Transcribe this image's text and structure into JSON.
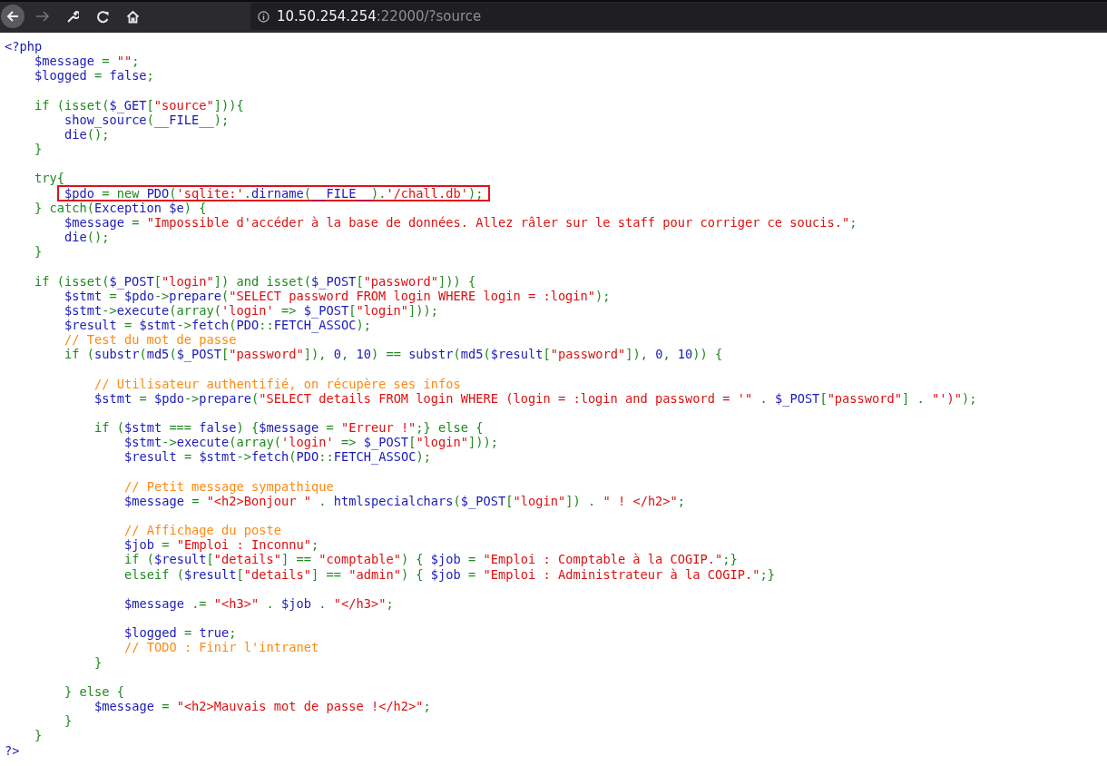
{
  "browser": {
    "url_host": "10.50.254.254",
    "url_rest": ":22000/?source"
  },
  "code": {
    "blocks": [
      [
        {
          "tokens": [
            {
              "kind": "default",
              "text": "<?php"
            }
          ]
        },
        {
          "tokens": [
            {
              "kind": "default",
              "text": "    $message"
            },
            {
              "kind": "keyword",
              "text": " = "
            },
            {
              "kind": "string",
              "text": "\"\""
            },
            {
              "kind": "keyword",
              "text": ";"
            }
          ]
        },
        {
          "tokens": [
            {
              "kind": "default",
              "text": "    $logged"
            },
            {
              "kind": "keyword",
              "text": " = "
            },
            {
              "kind": "default",
              "text": "false"
            },
            {
              "kind": "keyword",
              "text": ";"
            }
          ]
        }
      ],
      [
        {
          "tokens": [
            {
              "kind": "keyword",
              "text": "    if (isset("
            },
            {
              "kind": "default",
              "text": "$_GET"
            },
            {
              "kind": "keyword",
              "text": "["
            },
            {
              "kind": "string",
              "text": "\"source\""
            },
            {
              "kind": "keyword",
              "text": "])){"
            }
          ]
        },
        {
          "tokens": [
            {
              "kind": "default",
              "text": "        show_source"
            },
            {
              "kind": "keyword",
              "text": "("
            },
            {
              "kind": "default",
              "text": "__FILE__"
            },
            {
              "kind": "keyword",
              "text": ");"
            }
          ]
        },
        {
          "tokens": [
            {
              "kind": "default",
              "text": "        die"
            },
            {
              "kind": "keyword",
              "text": "();"
            }
          ]
        },
        {
          "tokens": [
            {
              "kind": "keyword",
              "text": "    }"
            }
          ]
        }
      ],
      [
        {
          "tokens": [
            {
              "kind": "keyword",
              "text": "    try{"
            }
          ]
        },
        {
          "boxed": true,
          "tokens": [
            {
              "kind": "default",
              "text": "        $pdo"
            },
            {
              "kind": "keyword",
              "text": " = new "
            },
            {
              "kind": "default",
              "text": "PDO"
            },
            {
              "kind": "keyword",
              "text": "("
            },
            {
              "kind": "string",
              "text": "'sqlite:'"
            },
            {
              "kind": "keyword",
              "text": "."
            },
            {
              "kind": "default",
              "text": "dirname"
            },
            {
              "kind": "keyword",
              "text": "("
            },
            {
              "kind": "default",
              "text": "__FILE__"
            },
            {
              "kind": "keyword",
              "text": ")."
            },
            {
              "kind": "string",
              "text": "'/chall.db'"
            },
            {
              "kind": "keyword",
              "text": ");"
            }
          ]
        },
        {
          "tokens": [
            {
              "kind": "keyword",
              "text": "    } catch("
            },
            {
              "kind": "default",
              "text": "Exception $e"
            },
            {
              "kind": "keyword",
              "text": ") {"
            }
          ]
        },
        {
          "tokens": [
            {
              "kind": "default",
              "text": "        $message"
            },
            {
              "kind": "keyword",
              "text": " = "
            },
            {
              "kind": "string",
              "text": "\"Impossible d'accéder à la base de données. Allez râler sur le staff pour corriger ce soucis.\""
            },
            {
              "kind": "keyword",
              "text": ";"
            }
          ]
        },
        {
          "tokens": [
            {
              "kind": "default",
              "text": "        die"
            },
            {
              "kind": "keyword",
              "text": "();"
            }
          ]
        },
        {
          "tokens": [
            {
              "kind": "keyword",
              "text": "    }"
            }
          ]
        }
      ],
      [
        {
          "tokens": [
            {
              "kind": "keyword",
              "text": "    if (isset("
            },
            {
              "kind": "default",
              "text": "$_POST"
            },
            {
              "kind": "keyword",
              "text": "["
            },
            {
              "kind": "string",
              "text": "\"login\""
            },
            {
              "kind": "keyword",
              "text": "]) and isset("
            },
            {
              "kind": "default",
              "text": "$_POST"
            },
            {
              "kind": "keyword",
              "text": "["
            },
            {
              "kind": "string",
              "text": "\"password\""
            },
            {
              "kind": "keyword",
              "text": "])) {"
            }
          ]
        },
        {
          "tokens": [
            {
              "kind": "default",
              "text": "        $stmt"
            },
            {
              "kind": "keyword",
              "text": " = "
            },
            {
              "kind": "default",
              "text": "$pdo"
            },
            {
              "kind": "keyword",
              "text": "->"
            },
            {
              "kind": "default",
              "text": "prepare"
            },
            {
              "kind": "keyword",
              "text": "("
            },
            {
              "kind": "string",
              "text": "\"SELECT password FROM login WHERE login = :login\""
            },
            {
              "kind": "keyword",
              "text": ");"
            }
          ]
        },
        {
          "tokens": [
            {
              "kind": "default",
              "text": "        $stmt"
            },
            {
              "kind": "keyword",
              "text": "->"
            },
            {
              "kind": "default",
              "text": "execute"
            },
            {
              "kind": "keyword",
              "text": "(array("
            },
            {
              "kind": "string",
              "text": "'login'"
            },
            {
              "kind": "keyword",
              "text": " => "
            },
            {
              "kind": "default",
              "text": "$_POST"
            },
            {
              "kind": "keyword",
              "text": "["
            },
            {
              "kind": "string",
              "text": "\"login\""
            },
            {
              "kind": "keyword",
              "text": "]));"
            }
          ]
        },
        {
          "tokens": [
            {
              "kind": "default",
              "text": "        $result"
            },
            {
              "kind": "keyword",
              "text": " = "
            },
            {
              "kind": "default",
              "text": "$stmt"
            },
            {
              "kind": "keyword",
              "text": "->"
            },
            {
              "kind": "default",
              "text": "fetch"
            },
            {
              "kind": "keyword",
              "text": "("
            },
            {
              "kind": "default",
              "text": "PDO"
            },
            {
              "kind": "keyword",
              "text": "::"
            },
            {
              "kind": "default",
              "text": "FETCH_ASSOC"
            },
            {
              "kind": "keyword",
              "text": ");"
            }
          ]
        },
        {
          "tokens": [
            {
              "kind": "comment",
              "text": "        // Test du mot de passe"
            }
          ]
        },
        {
          "tokens": [
            {
              "kind": "keyword",
              "text": "        if ("
            },
            {
              "kind": "default",
              "text": "substr"
            },
            {
              "kind": "keyword",
              "text": "("
            },
            {
              "kind": "default",
              "text": "md5"
            },
            {
              "kind": "keyword",
              "text": "("
            },
            {
              "kind": "default",
              "text": "$_POST"
            },
            {
              "kind": "keyword",
              "text": "["
            },
            {
              "kind": "string",
              "text": "\"password\""
            },
            {
              "kind": "keyword",
              "text": "]), "
            },
            {
              "kind": "default",
              "text": "0"
            },
            {
              "kind": "keyword",
              "text": ", "
            },
            {
              "kind": "default",
              "text": "10"
            },
            {
              "kind": "keyword",
              "text": ") == "
            },
            {
              "kind": "default",
              "text": "substr"
            },
            {
              "kind": "keyword",
              "text": "("
            },
            {
              "kind": "default",
              "text": "md5"
            },
            {
              "kind": "keyword",
              "text": "("
            },
            {
              "kind": "default",
              "text": "$result"
            },
            {
              "kind": "keyword",
              "text": "["
            },
            {
              "kind": "string",
              "text": "\"password\""
            },
            {
              "kind": "keyword",
              "text": "]), "
            },
            {
              "kind": "default",
              "text": "0"
            },
            {
              "kind": "keyword",
              "text": ", "
            },
            {
              "kind": "default",
              "text": "10"
            },
            {
              "kind": "keyword",
              "text": ")) {"
            }
          ]
        }
      ],
      [
        {
          "tokens": [
            {
              "kind": "comment",
              "text": "            // Utilisateur authentifié, on récupère ses infos"
            }
          ]
        },
        {
          "tokens": [
            {
              "kind": "default",
              "text": "            $stmt"
            },
            {
              "kind": "keyword",
              "text": " = "
            },
            {
              "kind": "default",
              "text": "$pdo"
            },
            {
              "kind": "keyword",
              "text": "->"
            },
            {
              "kind": "default",
              "text": "prepare"
            },
            {
              "kind": "keyword",
              "text": "("
            },
            {
              "kind": "string",
              "text": "\"SELECT details FROM login WHERE (login = :login and password = '\""
            },
            {
              "kind": "keyword",
              "text": " . "
            },
            {
              "kind": "default",
              "text": "$_POST"
            },
            {
              "kind": "keyword",
              "text": "["
            },
            {
              "kind": "string",
              "text": "\"password\""
            },
            {
              "kind": "keyword",
              "text": "] . "
            },
            {
              "kind": "string",
              "text": "\"')\""
            },
            {
              "kind": "keyword",
              "text": ");"
            }
          ]
        }
      ],
      [
        {
          "tokens": [
            {
              "kind": "keyword",
              "text": "            if ("
            },
            {
              "kind": "default",
              "text": "$stmt"
            },
            {
              "kind": "keyword",
              "text": " === "
            },
            {
              "kind": "default",
              "text": "false"
            },
            {
              "kind": "keyword",
              "text": ") {"
            },
            {
              "kind": "default",
              "text": "$message"
            },
            {
              "kind": "keyword",
              "text": " = "
            },
            {
              "kind": "string",
              "text": "\"Erreur !\""
            },
            {
              "kind": "keyword",
              "text": ";} else {"
            }
          ]
        },
        {
          "tokens": [
            {
              "kind": "default",
              "text": "                $stmt"
            },
            {
              "kind": "keyword",
              "text": "->"
            },
            {
              "kind": "default",
              "text": "execute"
            },
            {
              "kind": "keyword",
              "text": "(array("
            },
            {
              "kind": "string",
              "text": "'login'"
            },
            {
              "kind": "keyword",
              "text": " => "
            },
            {
              "kind": "default",
              "text": "$_POST"
            },
            {
              "kind": "keyword",
              "text": "["
            },
            {
              "kind": "string",
              "text": "\"login\""
            },
            {
              "kind": "keyword",
              "text": "]));"
            }
          ]
        },
        {
          "tokens": [
            {
              "kind": "default",
              "text": "                $result"
            },
            {
              "kind": "keyword",
              "text": " = "
            },
            {
              "kind": "default",
              "text": "$stmt"
            },
            {
              "kind": "keyword",
              "text": "->"
            },
            {
              "kind": "default",
              "text": "fetch"
            },
            {
              "kind": "keyword",
              "text": "("
            },
            {
              "kind": "default",
              "text": "PDO"
            },
            {
              "kind": "keyword",
              "text": "::"
            },
            {
              "kind": "default",
              "text": "FETCH_ASSOC"
            },
            {
              "kind": "keyword",
              "text": ");"
            }
          ]
        }
      ],
      [
        {
          "tokens": [
            {
              "kind": "comment",
              "text": "                // Petit message sympathique"
            }
          ]
        },
        {
          "tokens": [
            {
              "kind": "default",
              "text": "                $message"
            },
            {
              "kind": "keyword",
              "text": " = "
            },
            {
              "kind": "string",
              "text": "\"<h2>Bonjour \""
            },
            {
              "kind": "keyword",
              "text": " . "
            },
            {
              "kind": "default",
              "text": "htmlspecialchars"
            },
            {
              "kind": "keyword",
              "text": "("
            },
            {
              "kind": "default",
              "text": "$_POST"
            },
            {
              "kind": "keyword",
              "text": "["
            },
            {
              "kind": "string",
              "text": "\"login\""
            },
            {
              "kind": "keyword",
              "text": "]) . "
            },
            {
              "kind": "string",
              "text": "\" ! </h2>\""
            },
            {
              "kind": "keyword",
              "text": ";"
            }
          ]
        }
      ],
      [
        {
          "tokens": [
            {
              "kind": "comment",
              "text": "                // Affichage du poste"
            }
          ]
        },
        {
          "tokens": [
            {
              "kind": "default",
              "text": "                $job"
            },
            {
              "kind": "keyword",
              "text": " = "
            },
            {
              "kind": "string",
              "text": "\"Emploi : Inconnu\""
            },
            {
              "kind": "keyword",
              "text": ";"
            }
          ]
        },
        {
          "tokens": [
            {
              "kind": "keyword",
              "text": "                if ("
            },
            {
              "kind": "default",
              "text": "$result"
            },
            {
              "kind": "keyword",
              "text": "["
            },
            {
              "kind": "string",
              "text": "\"details\""
            },
            {
              "kind": "keyword",
              "text": "] == "
            },
            {
              "kind": "string",
              "text": "\"comptable\""
            },
            {
              "kind": "keyword",
              "text": ") { "
            },
            {
              "kind": "default",
              "text": "$job"
            },
            {
              "kind": "keyword",
              "text": " = "
            },
            {
              "kind": "string",
              "text": "\"Emploi : Comptable à la COGIP.\""
            },
            {
              "kind": "keyword",
              "text": ";}"
            }
          ]
        },
        {
          "tokens": [
            {
              "kind": "keyword",
              "text": "                elseif ("
            },
            {
              "kind": "default",
              "text": "$result"
            },
            {
              "kind": "keyword",
              "text": "["
            },
            {
              "kind": "string",
              "text": "\"details\""
            },
            {
              "kind": "keyword",
              "text": "] == "
            },
            {
              "kind": "string",
              "text": "\"admin\""
            },
            {
              "kind": "keyword",
              "text": ") { "
            },
            {
              "kind": "default",
              "text": "$job"
            },
            {
              "kind": "keyword",
              "text": " = "
            },
            {
              "kind": "string",
              "text": "\"Emploi : Administrateur à la COGIP.\""
            },
            {
              "kind": "keyword",
              "text": ";}"
            }
          ]
        }
      ],
      [
        {
          "tokens": [
            {
              "kind": "default",
              "text": "                $message"
            },
            {
              "kind": "keyword",
              "text": " .= "
            },
            {
              "kind": "string",
              "text": "\"<h3>\""
            },
            {
              "kind": "keyword",
              "text": " . "
            },
            {
              "kind": "default",
              "text": "$job"
            },
            {
              "kind": "keyword",
              "text": " . "
            },
            {
              "kind": "string",
              "text": "\"</h3>\""
            },
            {
              "kind": "keyword",
              "text": ";"
            }
          ]
        }
      ],
      [
        {
          "tokens": [
            {
              "kind": "default",
              "text": "                $logged"
            },
            {
              "kind": "keyword",
              "text": " = "
            },
            {
              "kind": "default",
              "text": "true"
            },
            {
              "kind": "keyword",
              "text": ";"
            }
          ]
        },
        {
          "tokens": [
            {
              "kind": "comment",
              "text": "                // TODO : Finir l'intranet"
            }
          ]
        },
        {
          "tokens": [
            {
              "kind": "keyword",
              "text": "            }"
            }
          ]
        }
      ],
      [
        {
          "tokens": [
            {
              "kind": "keyword",
              "text": "        } else {"
            }
          ]
        },
        {
          "tokens": [
            {
              "kind": "default",
              "text": "            $message"
            },
            {
              "kind": "keyword",
              "text": " = "
            },
            {
              "kind": "string",
              "text": "\"<h2>Mauvais mot de passe !</h2>\""
            },
            {
              "kind": "keyword",
              "text": ";"
            }
          ]
        },
        {
          "tokens": [
            {
              "kind": "keyword",
              "text": "        }"
            }
          ]
        },
        {
          "tokens": [
            {
              "kind": "keyword",
              "text": "    }"
            }
          ]
        },
        {
          "tokens": [
            {
              "kind": "default",
              "text": "?>"
            }
          ]
        }
      ]
    ]
  }
}
